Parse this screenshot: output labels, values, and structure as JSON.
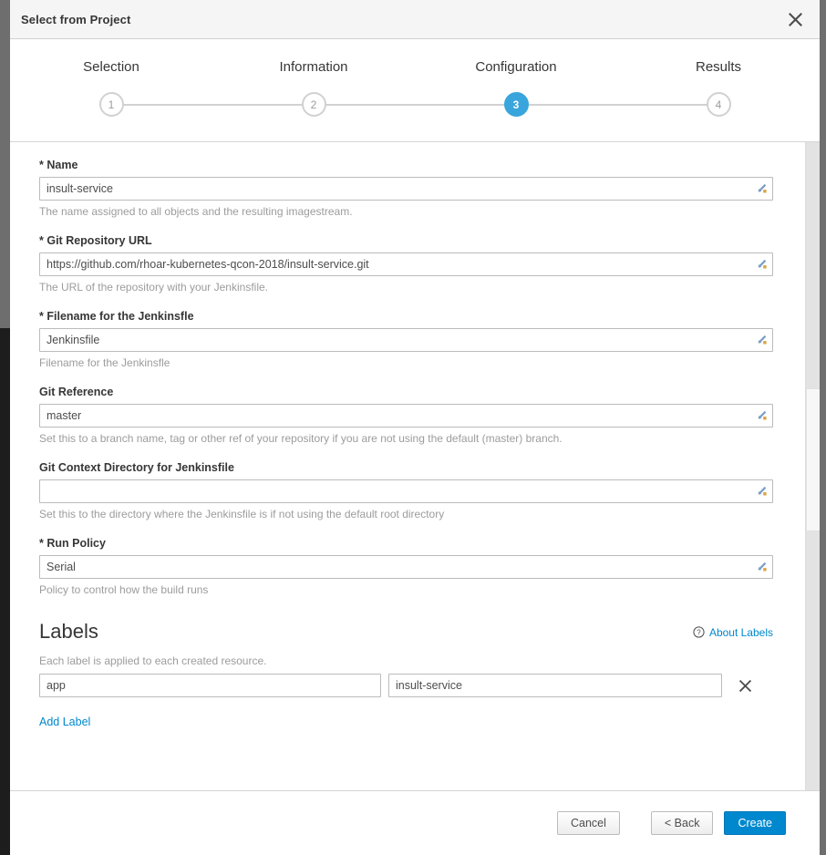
{
  "modal": {
    "title": "Select from Project",
    "close_icon": "close-icon"
  },
  "wizard": {
    "steps": [
      {
        "label": "Selection",
        "number": "1",
        "active": false
      },
      {
        "label": "Information",
        "number": "2",
        "active": false
      },
      {
        "label": "Configuration",
        "number": "3",
        "active": true
      },
      {
        "label": "Results",
        "number": "4",
        "active": false
      }
    ],
    "active_color": "#39a5dc",
    "inactive_color": "#d1d1d1"
  },
  "form": {
    "fields": [
      {
        "label": "Name",
        "required": true,
        "value": "insult-service",
        "placeholder": "",
        "help": "The name assigned to all objects and the resulting imagestream.",
        "name": "name"
      },
      {
        "label": "Git Repository URL",
        "required": true,
        "value": "https://github.com/rhoar-kubernetes-qcon-2018/insult-service.git",
        "placeholder": "",
        "help": "The URL of the repository with your Jenkinsfile.",
        "name": "git-repository-url"
      },
      {
        "label": "Filename for the Jenkinsfle",
        "required": true,
        "value": "Jenkinsfile",
        "placeholder": "",
        "help": "Filename for the Jenkinsfle",
        "name": "jenkinsfile-filename"
      },
      {
        "label": "Git Reference",
        "required": false,
        "value": "master",
        "placeholder": "",
        "help": "Set this to a branch name, tag or other ref of your repository if you are not using the default (master) branch.",
        "name": "git-reference"
      },
      {
        "label": "Git Context Directory for Jenkinsfile",
        "required": false,
        "value": "",
        "placeholder": "",
        "help": "Set this to the directory where the Jenkinsfile is if not using the default root directory",
        "name": "git-context-directory"
      },
      {
        "label": "Run Policy",
        "required": true,
        "value": "Serial",
        "placeholder": "",
        "help": "Policy to control how the build runs",
        "name": "run-policy"
      }
    ],
    "required_marker": "*"
  },
  "labels_section": {
    "title": "Labels",
    "about_link": "About Labels",
    "about_icon": "help-circle-icon",
    "description": "Each label is applied to each created resource.",
    "add_link": "Add Label",
    "rows": [
      {
        "key": "app",
        "value": "insult-service",
        "key_placeholder": "",
        "value_placeholder": "",
        "remove_icon": "close-icon"
      }
    ]
  },
  "footer": {
    "cancel_label": "Cancel",
    "back_label": "< Back",
    "create_label": "Create",
    "primary_color": "#0088ce"
  },
  "scrollbar": {
    "thumb_top_pct": 38,
    "thumb_height_pct": 22
  }
}
